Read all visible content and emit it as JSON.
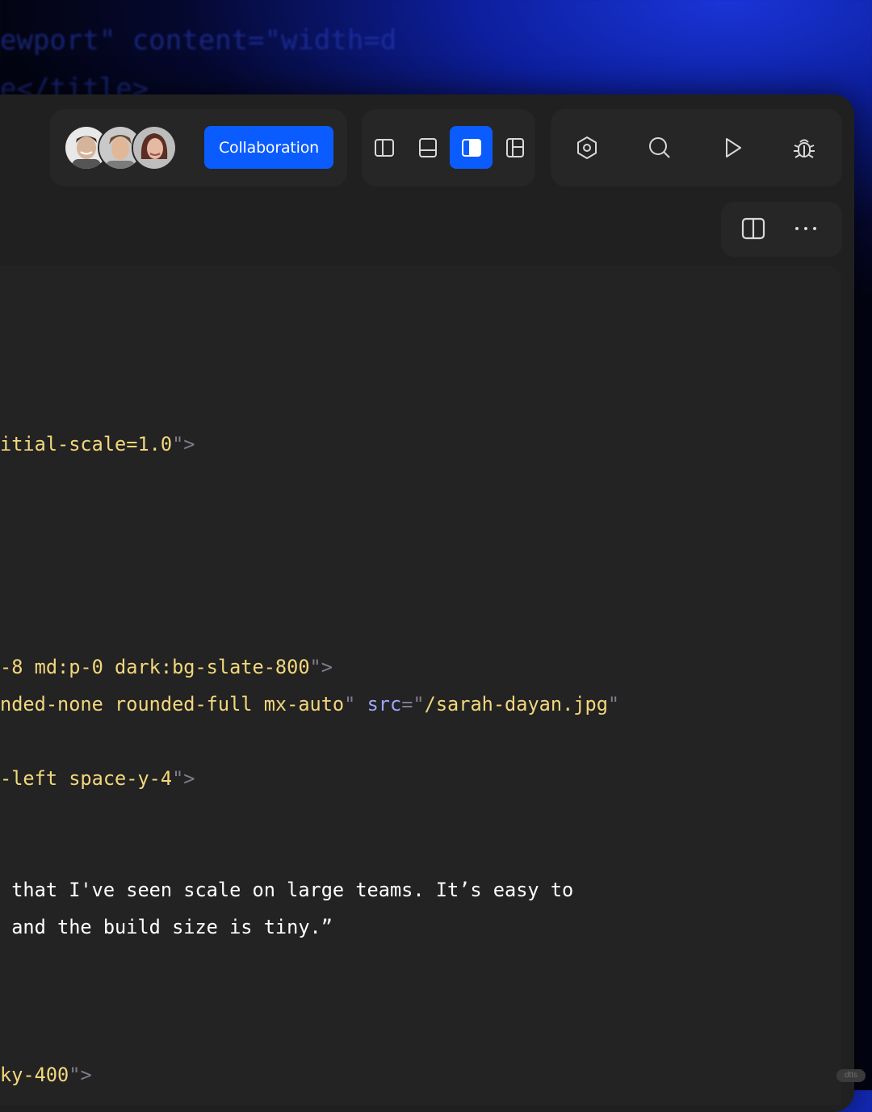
{
  "background_code": [
    "ewport\" content=\"width=d",
    "e</title>"
  ],
  "header": {
    "avatars": [
      {
        "label": "User 1",
        "skin": "#d6b49a",
        "hair": "#3a2a22",
        "bg": "#e8e8e8"
      },
      {
        "label": "User 2",
        "skin": "#e0b898",
        "hair": "#6b4a2e",
        "bg": "#c9c9c9"
      },
      {
        "label": "User 3",
        "skin": "#e6b9a2",
        "hair": "#5a2e22",
        "bg": "#bdbdbd"
      }
    ],
    "collaboration_label": "Collaboration",
    "layout_icons": [
      "sidebar-left-icon",
      "panel-bottom-icon",
      "columns-active-icon",
      "layout-grid-icon"
    ],
    "tool_icons": [
      "settings-icon",
      "search-icon",
      "play-icon",
      "bug-icon"
    ]
  },
  "tabs_toolbar": {
    "icons": [
      "split-view-icon",
      "more-icon"
    ]
  },
  "code": {
    "line1": {
      "value": "itial-scale=1.0",
      "close": "\">"
    },
    "line2": {
      "value": "-8 md:p-0 dark:bg-slate-800",
      "close": "\">"
    },
    "line3": {
      "value": "nded-none rounded-full mx-auto",
      "q1": "\"",
      "attr": "src",
      "eq": "=\"",
      "src": "/sarah-dayan.jpg",
      "q2": "\""
    },
    "line4": {
      "value": "-left space-y-4",
      "close": "\">"
    },
    "line5": {
      "text": " that I've seen scale on large teams. It’s easy to"
    },
    "line6": {
      "text": " and the build size is tiny.”"
    },
    "line7": {
      "value": "ky-400",
      "close": "\">"
    }
  },
  "colors": {
    "accent": "#0a5cff",
    "string": "#f3d77b",
    "attribute": "#9fa4ff",
    "punctuation": "#7d7d8e",
    "editor_bg": "#232323"
  },
  "watermark": "dtts"
}
